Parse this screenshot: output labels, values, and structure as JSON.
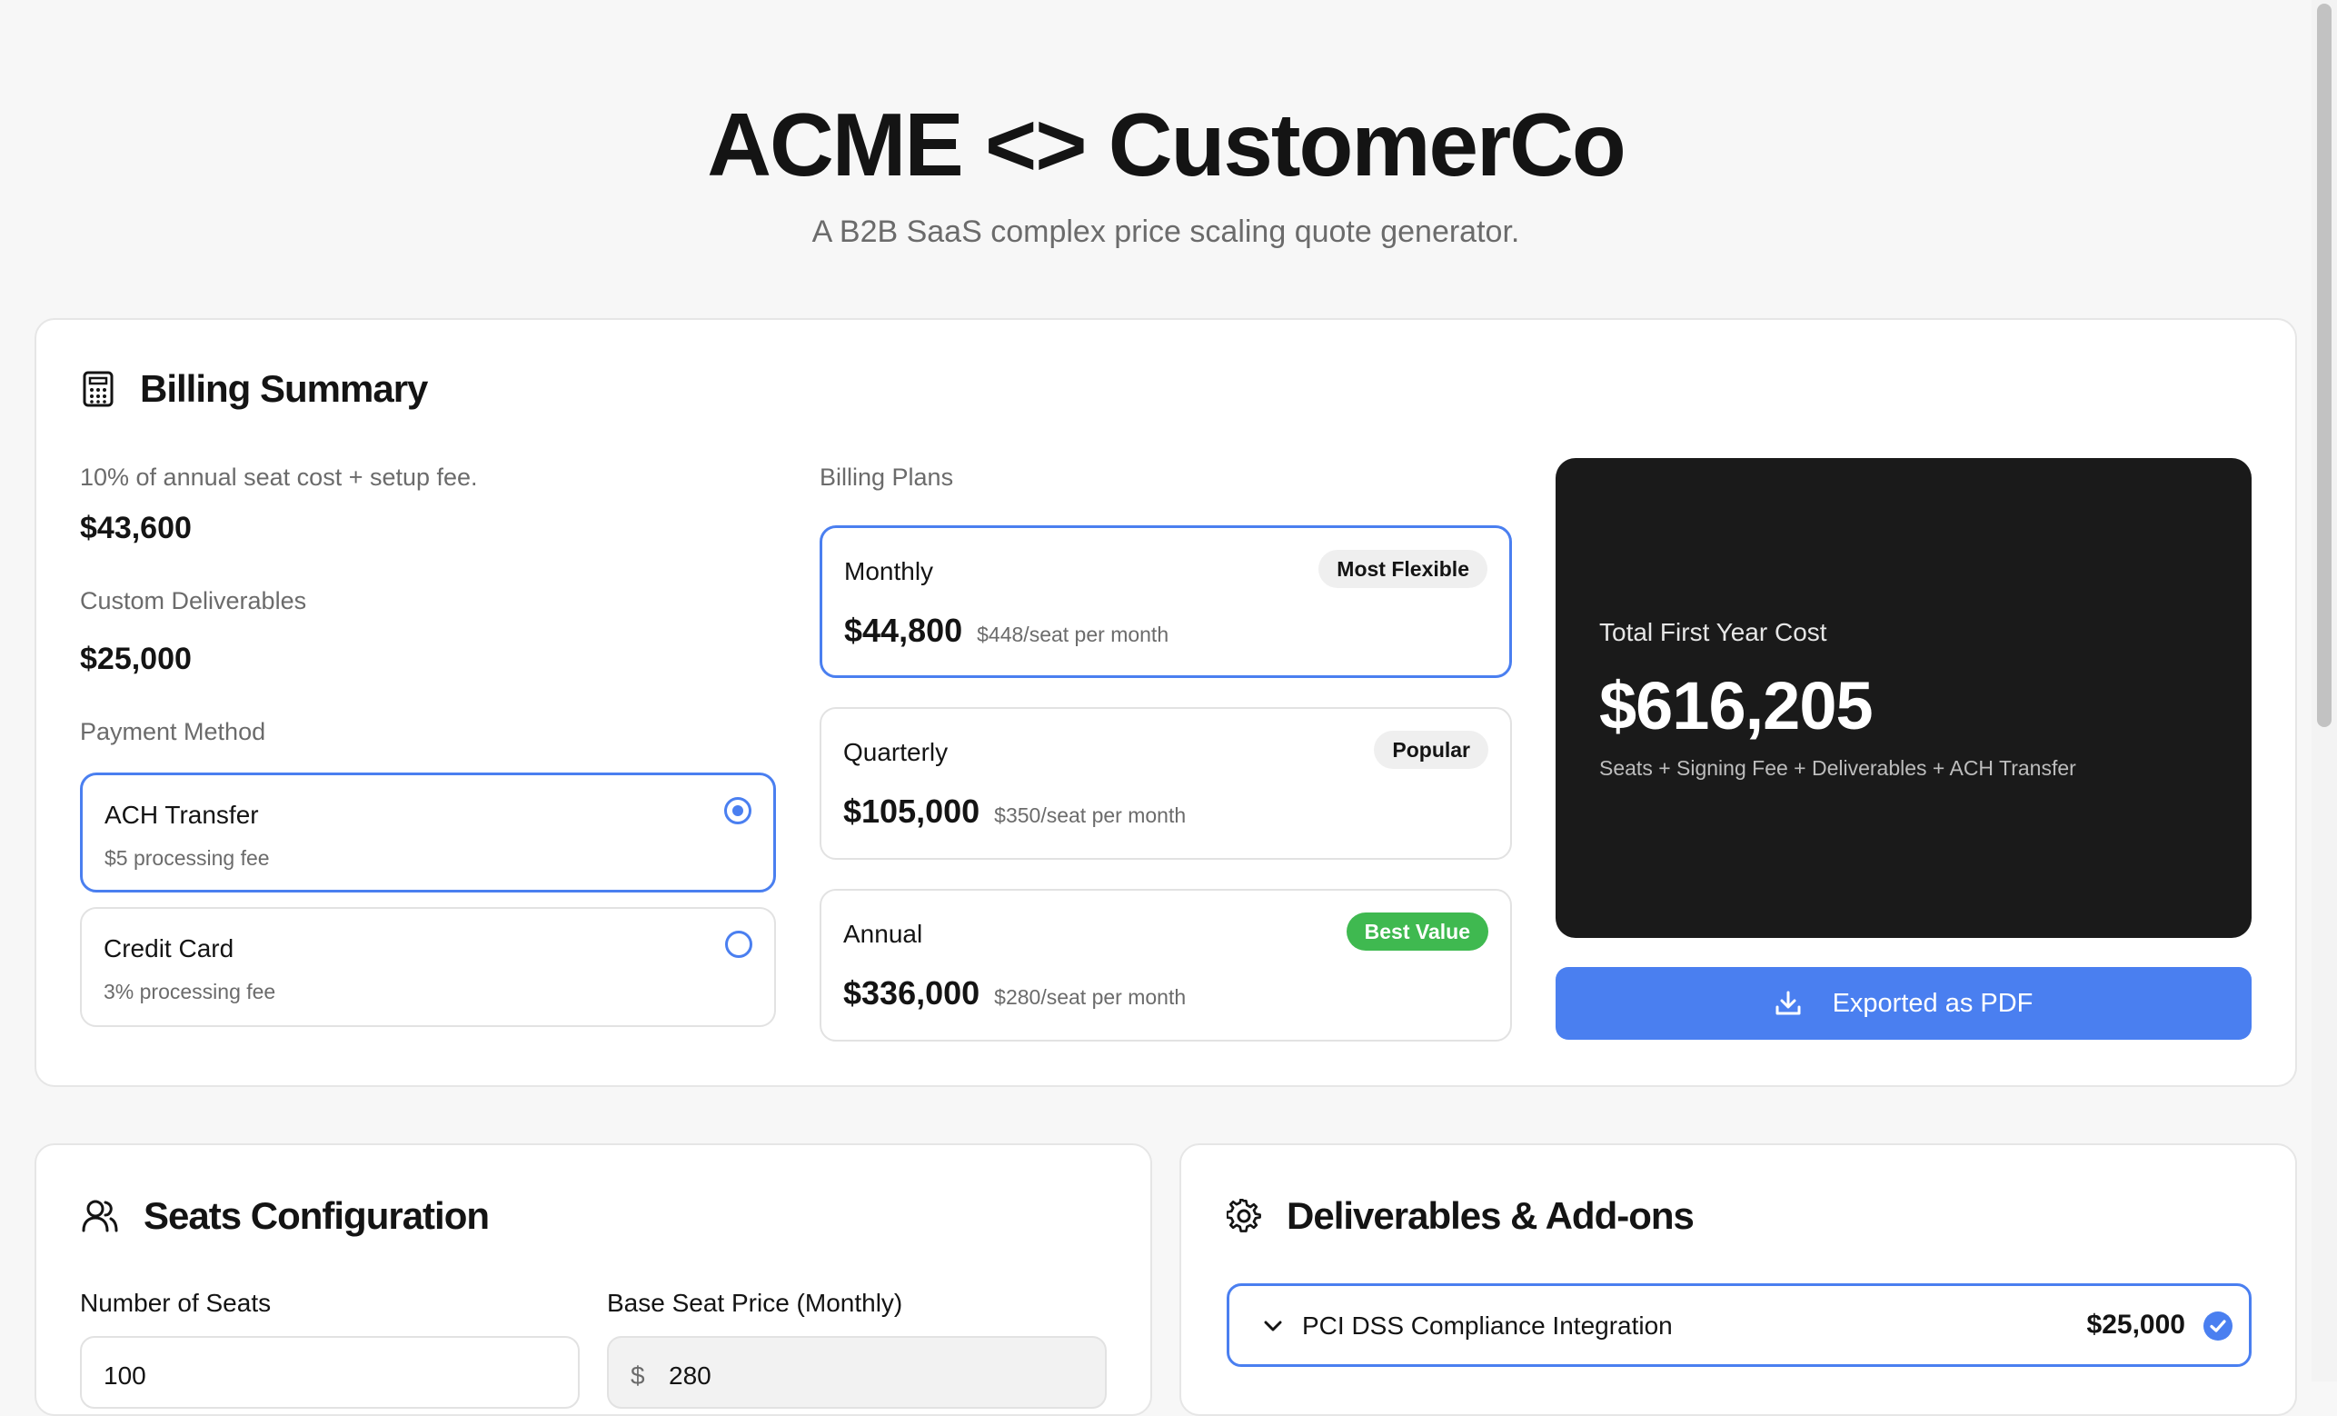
{
  "header": {
    "title": "ACME <> CustomerCo",
    "subtitle": "A B2B SaaS complex price scaling quote generator."
  },
  "billing_summary": {
    "title": "Billing Summary",
    "setup_label": "10% of annual seat cost + setup fee.",
    "setup_value": "$43,600",
    "deliverables_label": "Custom Deliverables",
    "deliverables_value": "$25,000",
    "payment_method_label": "Payment Method",
    "payment_methods": [
      {
        "name": "ACH Transfer",
        "fee": "$5 processing fee",
        "selected": true
      },
      {
        "name": "Credit Card",
        "fee": "3% processing fee",
        "selected": false
      }
    ],
    "billing_plans_label": "Billing Plans",
    "plans": [
      {
        "name": "Monthly",
        "badge": "Most Flexible",
        "price": "$44,800",
        "per_seat": "$448/seat per month",
        "selected": true
      },
      {
        "name": "Quarterly",
        "badge": "Popular",
        "price": "$105,000",
        "per_seat": "$350/seat per month",
        "selected": false
      },
      {
        "name": "Annual",
        "badge": "Best Value",
        "price": "$336,000",
        "per_seat": "$280/seat per month",
        "selected": false
      }
    ],
    "total": {
      "label": "Total First Year Cost",
      "value": "$616,205",
      "note": "Seats + Signing Fee + Deliverables + ACH Transfer"
    },
    "export_label": "Exported as PDF"
  },
  "seats": {
    "title": "Seats Configuration",
    "seats_label": "Number of Seats",
    "seats_value": "100",
    "base_price_label": "Base Seat Price (Monthly)",
    "currency_symbol": "$",
    "base_price_value": "280"
  },
  "deliverables": {
    "title": "Deliverables & Add-ons",
    "items": [
      {
        "name": "PCI DSS Compliance Integration",
        "price": "$25,000",
        "checked": true
      }
    ]
  },
  "colors": {
    "accent": "#4a7ff0",
    "dark_panel": "#1a1a1a",
    "success": "#3fb950",
    "page_bg": "#f7f7f7"
  },
  "icons": {
    "billing": "calculator-icon",
    "seats": "users-icon",
    "deliverables": "gear-icon",
    "export": "download-icon",
    "expand": "chevron-down-icon",
    "checked": "check-circle-icon"
  }
}
